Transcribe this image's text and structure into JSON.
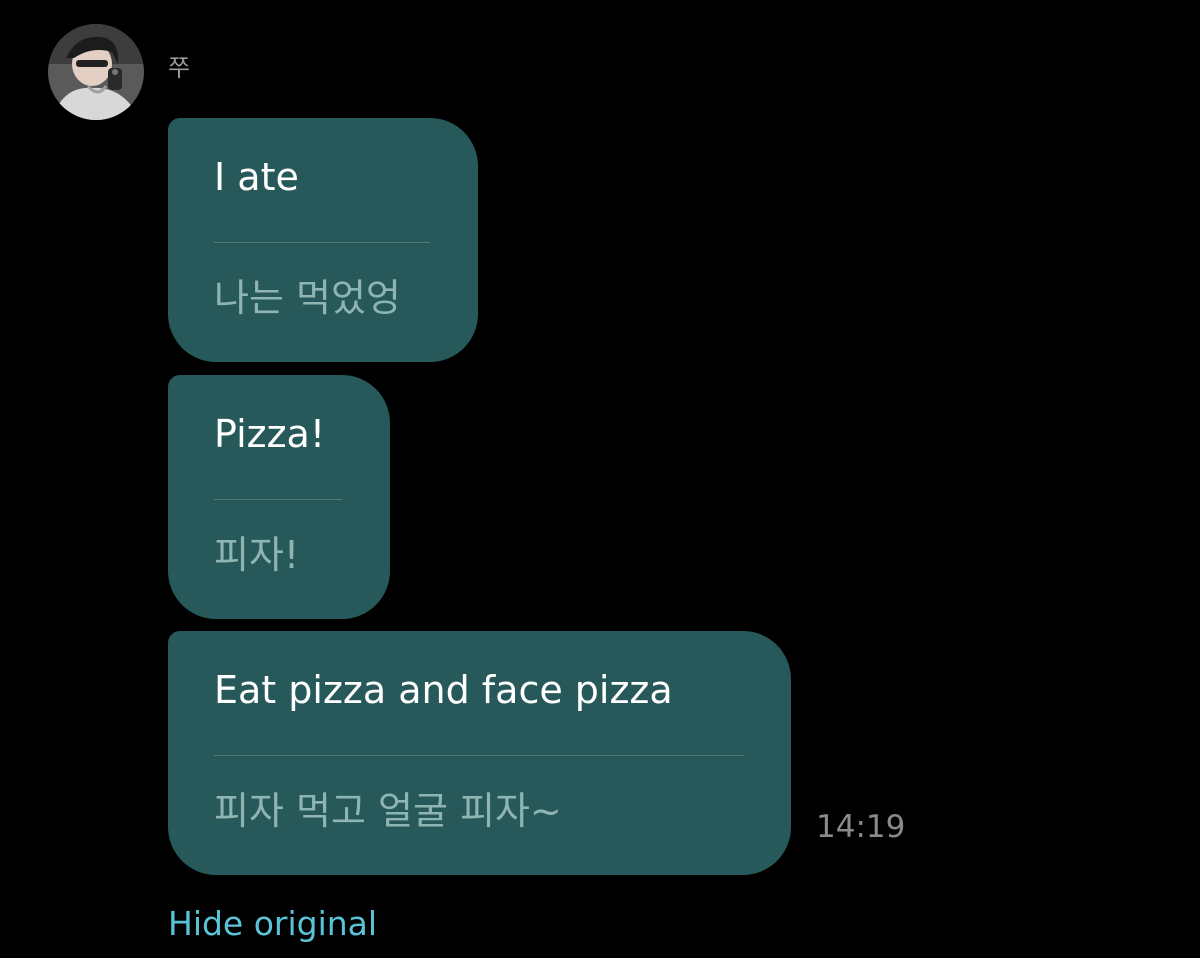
{
  "sender": {
    "name": "쭈",
    "avatar": "avatar-photo"
  },
  "messages": [
    {
      "original": "I ate",
      "translation": "나는 먹었엉"
    },
    {
      "original": "Pizza!",
      "translation": "피자!"
    },
    {
      "original": "Eat pizza and face pizza",
      "translation": "피자 먹고 얼굴 피자~"
    }
  ],
  "timestamp": "14:19",
  "hide_original_label": "Hide original",
  "colors": {
    "background": "#000000",
    "bubble": "#27595a",
    "translation_text": "#8fb5b3",
    "link": "#5bc3d8"
  }
}
